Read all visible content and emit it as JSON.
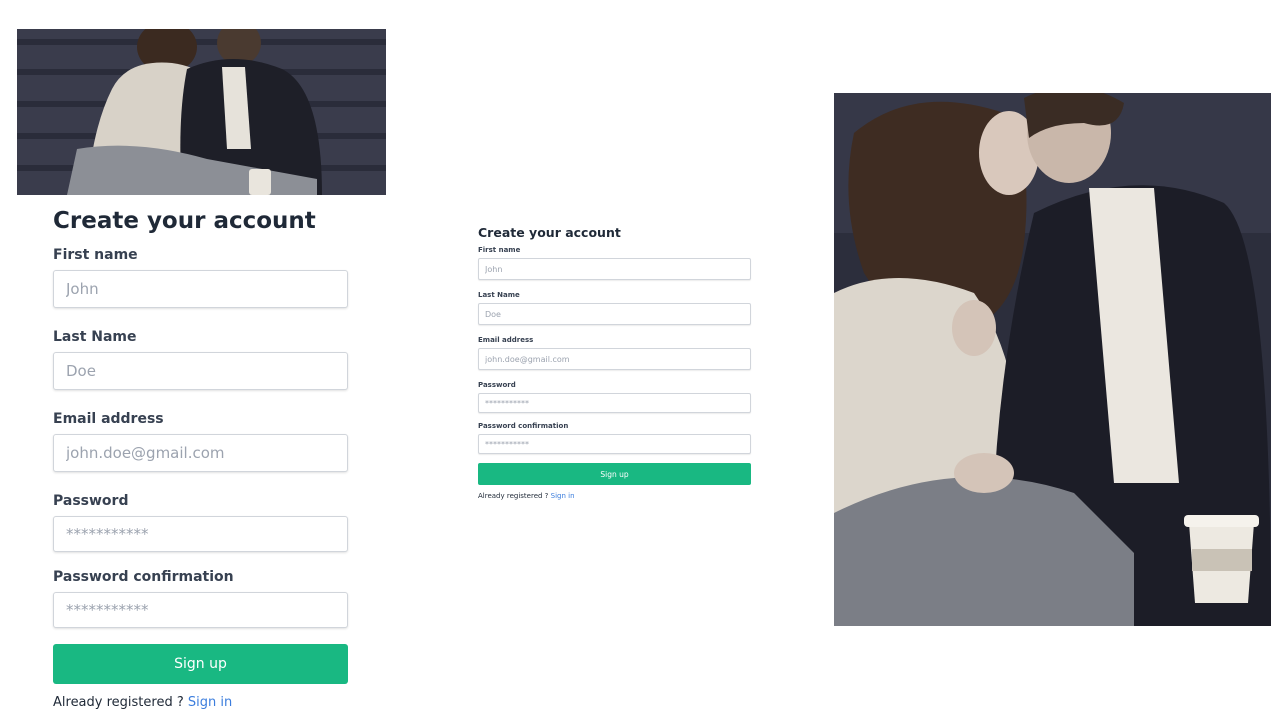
{
  "images": {
    "top_photo_alt": "couple-photo",
    "right_photo_alt": "couple-photo"
  },
  "colors": {
    "accent": "#19b882",
    "link": "#3b7ddd",
    "heading": "#1f2937"
  },
  "form_large": {
    "title": "Create your account",
    "first_name_label": "First name",
    "first_name_placeholder": "John",
    "last_name_label": "Last Name",
    "last_name_placeholder": "Doe",
    "email_label": "Email address",
    "email_placeholder": "john.doe@gmail.com",
    "password_label": "Password",
    "password_placeholder": "***********",
    "password_confirm_label": "Password confirmation",
    "password_confirm_placeholder": "***********",
    "submit_label": "Sign up",
    "footer_text": "Already registered ? ",
    "footer_link": "Sign in"
  },
  "form_small": {
    "title": "Create your account",
    "first_name_label": "First name",
    "first_name_placeholder": "John",
    "last_name_label": "Last Name",
    "last_name_placeholder": "Doe",
    "email_label": "Email address",
    "email_placeholder": "john.doe@gmail.com",
    "password_label": "Password",
    "password_placeholder": "***********",
    "password_confirm_label": "Password confirmation",
    "password_confirm_placeholder": "***********",
    "submit_label": "Sign up",
    "footer_text": "Already registered ? ",
    "footer_link": "Sign in"
  }
}
